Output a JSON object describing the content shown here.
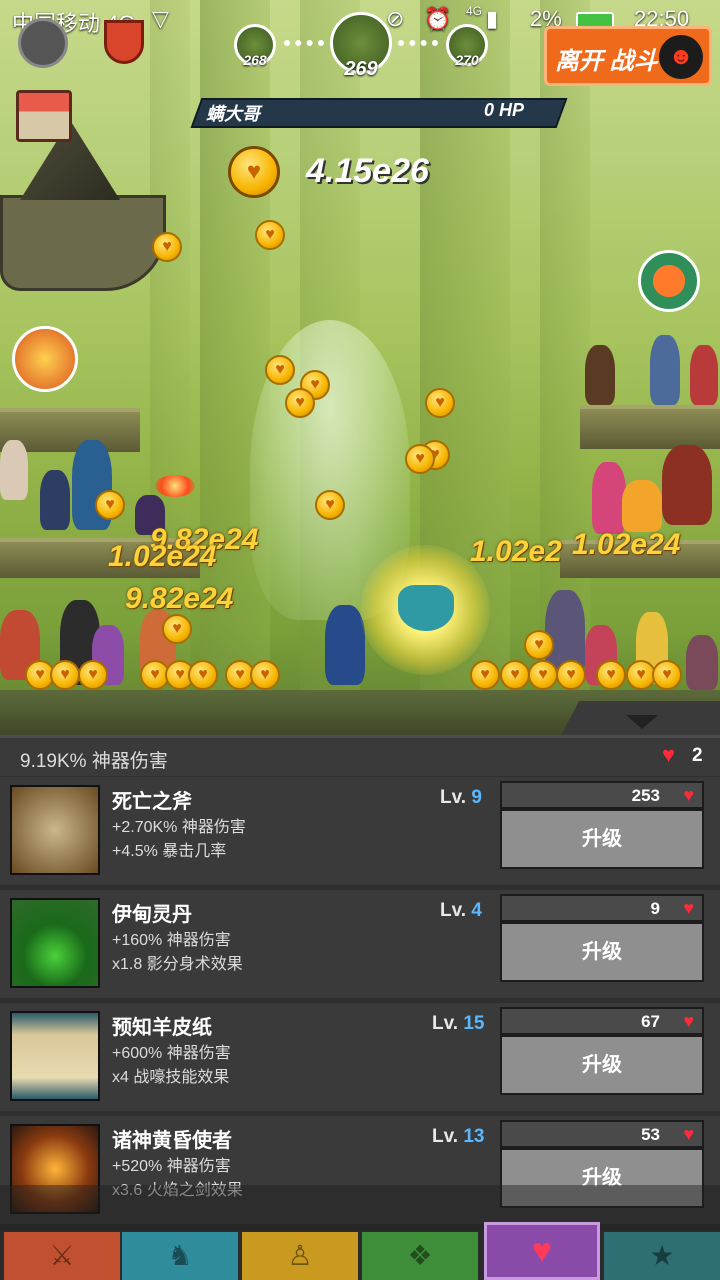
{
  "status_bar": {
    "carrier": "中国移动 4G",
    "battery": "2%",
    "time": "22:50",
    "network": "4G"
  },
  "hud": {
    "stages": {
      "prev": "268",
      "current": "269",
      "next": "270"
    },
    "leave_button": "离开 战斗",
    "boss_name": "螨大哥",
    "boss_hp": "0 HP",
    "gold": "4.15e26"
  },
  "damage_popups": [
    "9.82e24",
    "1.02e24",
    "9.82e24",
    "1.02e2",
    "1.02e24"
  ],
  "panel": {
    "summary": "9.19K% 神器伤害",
    "currency_count": "2",
    "items": [
      {
        "name": "死亡之斧",
        "stat1": "+2.70K% 神器伤害",
        "stat2": "+4.5% 暴击几率",
        "lv_label": "Lv.",
        "level": "9",
        "cost": "253",
        "button": "升级",
        "icon": "axe-icon"
      },
      {
        "name": "伊甸灵丹",
        "stat1": "+160% 神器伤害",
        "stat2": "x1.8 影分身术效果",
        "lv_label": "Lv.",
        "level": "4",
        "cost": "9",
        "button": "升级",
        "icon": "potion-icon"
      },
      {
        "name": "预知羊皮纸",
        "stat1": "+600% 神器伤害",
        "stat2": "x4 战嚎技能效果",
        "lv_label": "Lv.",
        "level": "15",
        "cost": "67",
        "button": "升级",
        "icon": "scroll-icon"
      },
      {
        "name": "诸神黄昏使者",
        "stat1": "+520% 神器伤害",
        "stat2": "x3.6 火焰之剑效果",
        "lv_label": "Lv.",
        "level": "13",
        "cost": "53",
        "button": "升级",
        "icon": "hammer-icon"
      }
    ]
  },
  "tabs": [
    {
      "name": "sword",
      "color": "#c0502f",
      "glyph": "⚔"
    },
    {
      "name": "heroes",
      "color": "#2f8c9c",
      "glyph": "♞"
    },
    {
      "name": "equipment",
      "color": "#c99a1f",
      "glyph": "♙"
    },
    {
      "name": "pets",
      "color": "#3f8f3a",
      "glyph": "❖"
    },
    {
      "name": "artifacts",
      "color": "#8a4aa8",
      "glyph": "♥"
    },
    {
      "name": "shop",
      "color": "#2d6f73",
      "glyph": "★"
    }
  ]
}
